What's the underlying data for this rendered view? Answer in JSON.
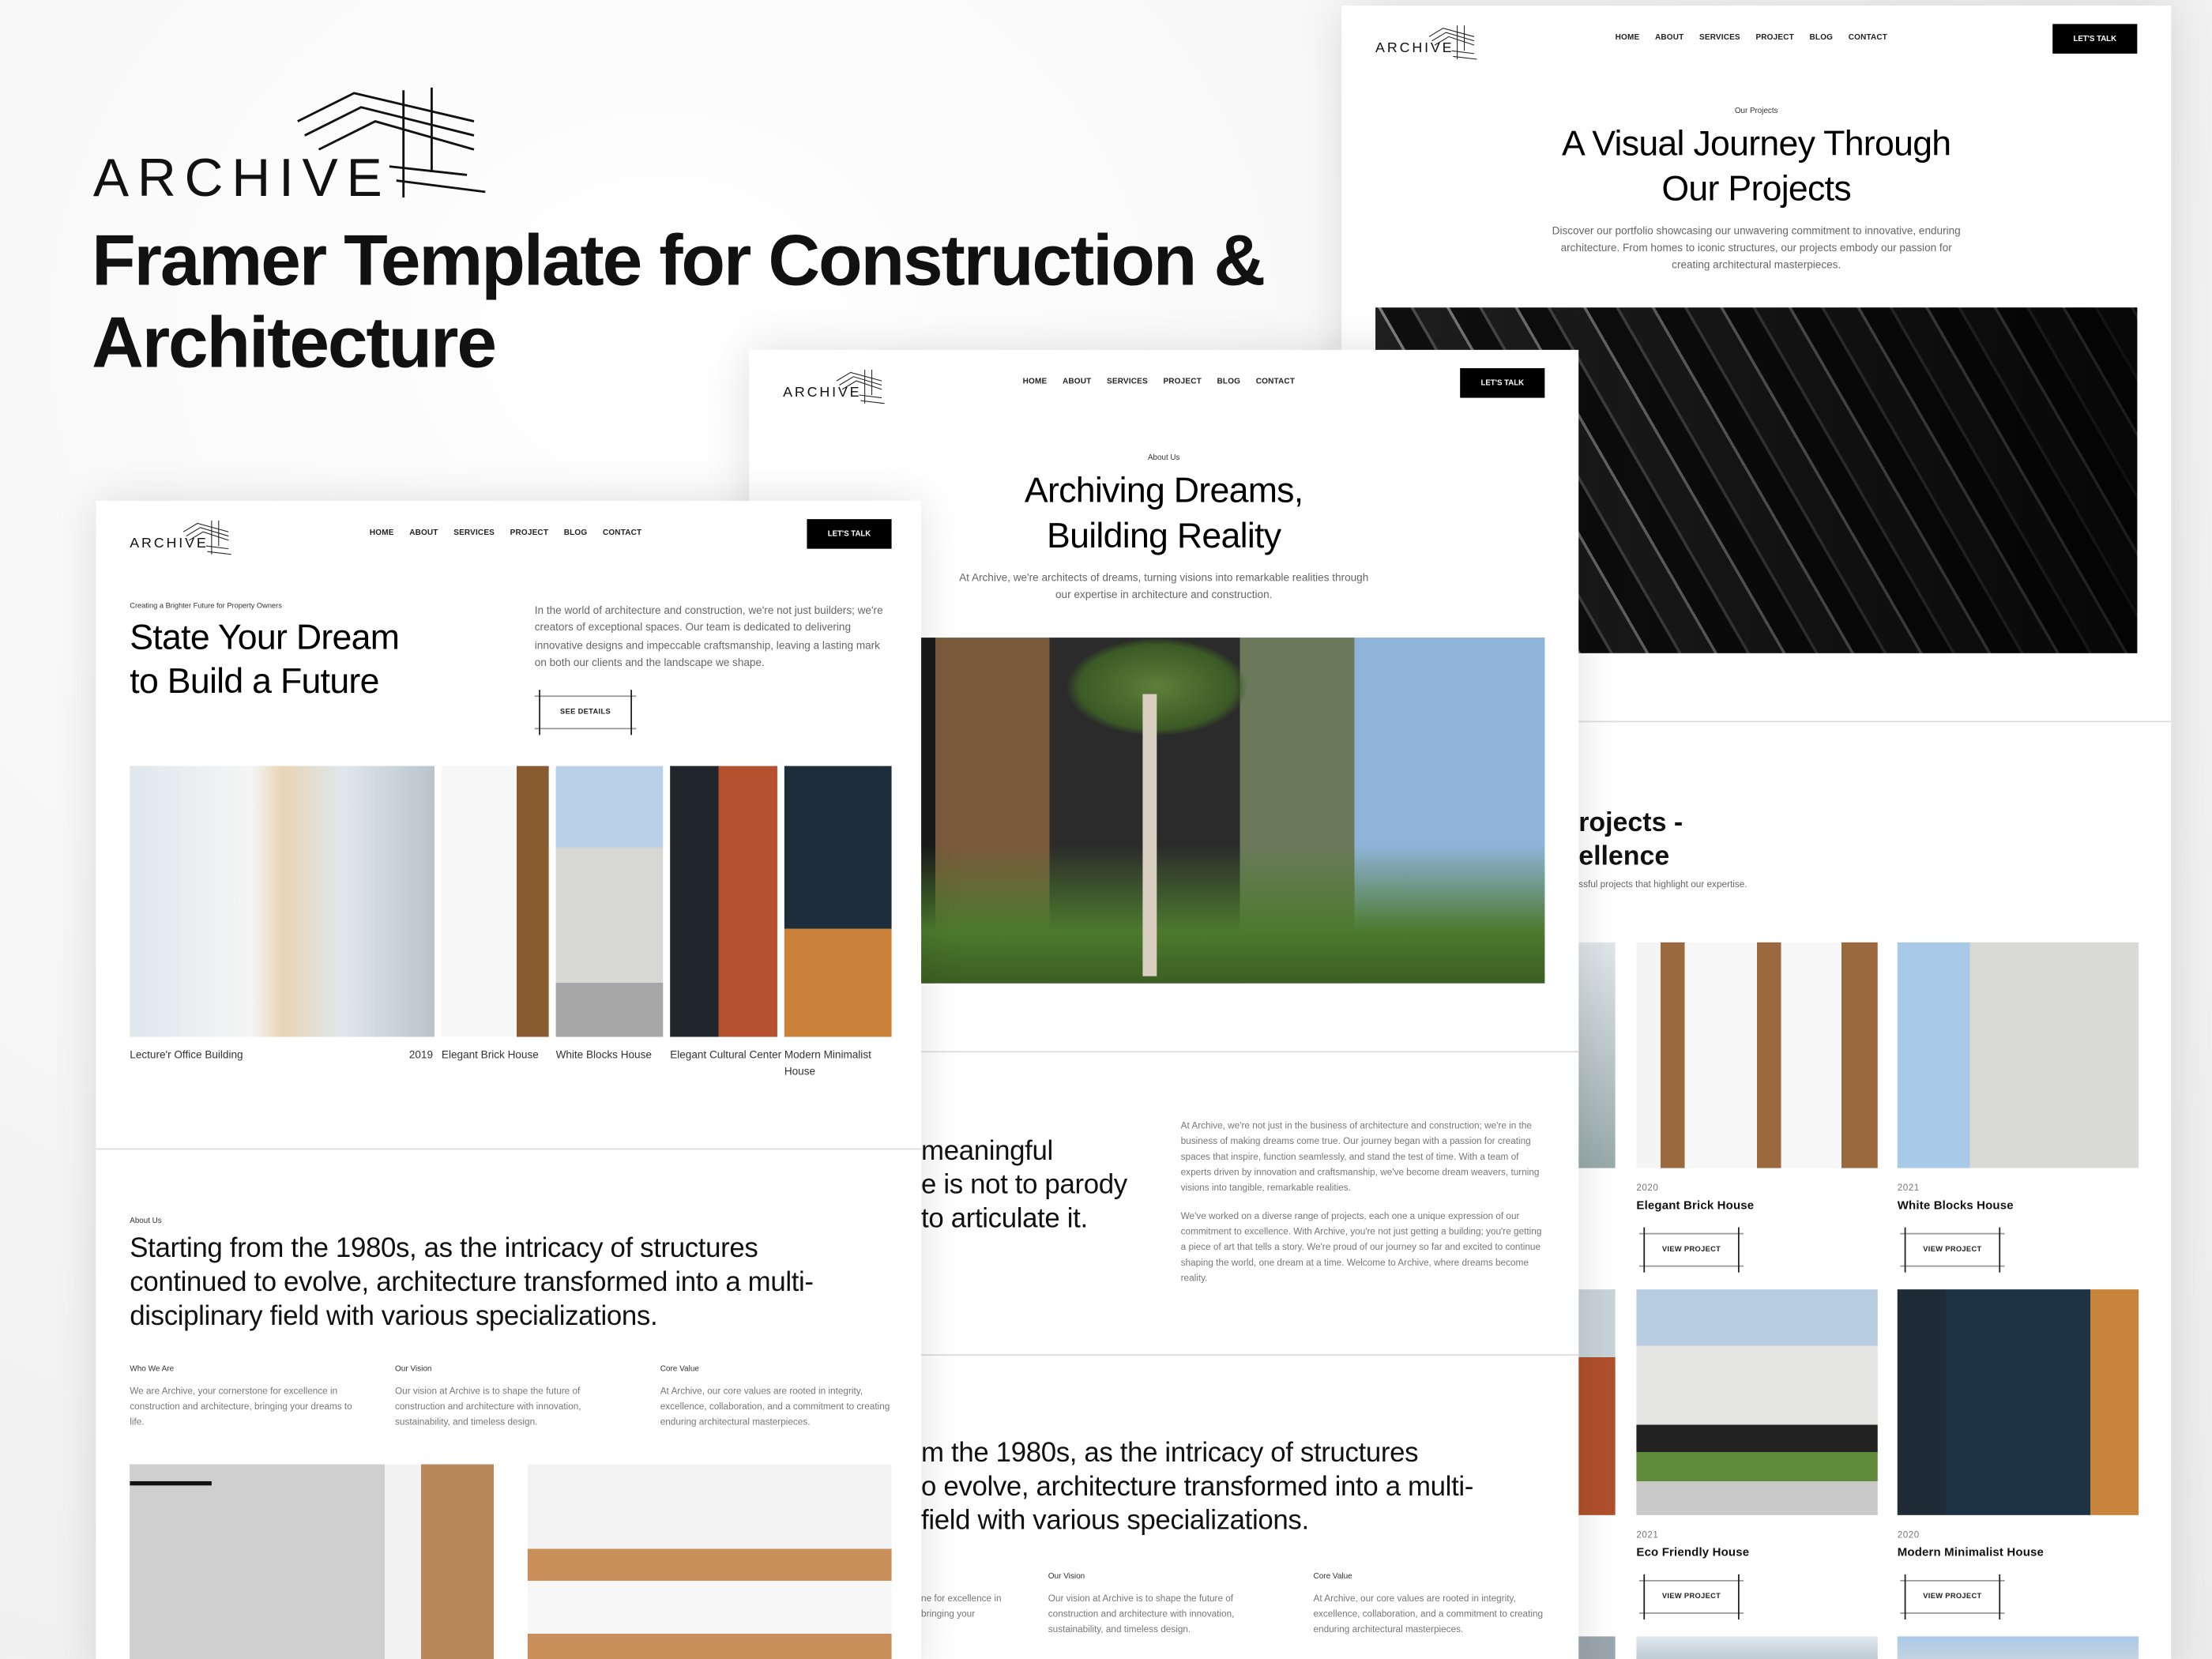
{
  "hero": {
    "logo_text": "ARCHIVE",
    "title_line1": "Framer Template for Construction &",
    "title_line2": "Architecture"
  },
  "nav": {
    "logo_text": "ARCHIVE",
    "items": [
      "HOME",
      "ABOUT",
      "SERVICES",
      "PROJECT",
      "BLOG",
      "CONTACT"
    ],
    "cta": "LET'S TALK"
  },
  "projects_page": {
    "eyebrow": "Our Projects",
    "title_line1": "A Visual Journey Through",
    "title_line2": "Our Projects",
    "description": "Discover our portfolio showcasing our unwavering commitment to innovative, enduring architecture. From homes to iconic structures, our projects embody our passion for creating architectural masterpieces.",
    "section_title_line1": "rojects -",
    "section_title_line2": "ellence",
    "section_sub": "ssful projects that highlight our expertise.",
    "button_label": "VIEW PROJECT",
    "projects": [
      {
        "year": "2020",
        "title": "Elegant Brick House"
      },
      {
        "year": "2021",
        "title": "White Blocks House"
      },
      {
        "year": "2021",
        "title": "Eco Friendly House"
      },
      {
        "year": "2020",
        "title": "Modern Minimalist House"
      }
    ]
  },
  "about_page": {
    "eyebrow": "About Us",
    "title_line1": "Archiving Dreams,",
    "title_line2": "Building Reality",
    "description": "At Archive, we're architects of dreams, turning visions into remarkable realities through our expertise in architecture and construction.",
    "quote_lines": [
      "meaningful",
      "e is not to parody",
      "to articulate it."
    ],
    "paragraph1": "At Archive, we're not just in the business of architecture and construction; we're in the business of making dreams come true. Our journey began with a passion for creating spaces that inspire, function seamlessly, and stand the test of time. With a team of experts driven by innovation and craftsmanship, we've become dream weavers, turning visions into tangible, remarkable realities.",
    "paragraph2": "We've worked on a diverse range of projects, each one a unique expression of our commitment to excellence. With Archive, you're not just getting a building; you're getting a piece of art that tells a story. We're proud of our journey so far and excited to continue shaping the world, one dream at a time. Welcome to Archive, where dreams become reality.",
    "big_lines": [
      "m the 1980s, as the intricacy of structures",
      "o evolve, architecture transformed into a multi-",
      "field with various specializations."
    ],
    "partial_col_lines": [
      "ne for excellence in",
      "bringing your"
    ],
    "vision_title": "Our Vision",
    "vision_text": "Our vision at Archive is to shape the future of construction and architecture with innovation, sustainability, and timeless design.",
    "core_title": "Core Value",
    "core_text": "At Archive, our core values are rooted in integrity, excellence, collaboration, and a commitment to creating enduring architectural masterpieces."
  },
  "home_page": {
    "eyebrow": "Creating a Brighter Future for Property Owners",
    "title_line1": "State Your Dream",
    "title_line2": "to Build a Future",
    "intro": "In the world of architecture and construction, we're not just builders; we're creators of exceptional spaces. Our team is dedicated to delivering innovative designs and impeccable craftsmanship, leaving a lasting mark on both our clients and the landscape we shape.",
    "see_details": "SEE DETAILS",
    "gallery": [
      {
        "caption": "Lecture'r Office Building",
        "year": "2019"
      },
      {
        "caption": "Elegant Brick House"
      },
      {
        "caption": "White Blocks House"
      },
      {
        "caption": "Elegant Cultural Center"
      },
      {
        "caption": "Modern Minimalist House"
      }
    ],
    "about_eyebrow": "About Us",
    "about_text": "Starting from the 1980s, as the intricacy of structures continued to evolve, architecture transformed into a multi-disciplinary field with various specializations.",
    "columns": [
      {
        "title": "Who We Are",
        "text": "We are Archive, your cornerstone for excellence in construction and architecture, bringing your dreams to life."
      },
      {
        "title": "Our Vision",
        "text": "Our vision at Archive is to shape the future of construction and architecture with innovation, sustainability, and timeless design."
      },
      {
        "title": "Core Value",
        "text": "At Archive, our core values are rooted in integrity, excellence, collaboration, and a commitment to creating enduring architectural masterpieces."
      }
    ]
  },
  "colors": {
    "accent": "#000000",
    "background": "#f2f2f2",
    "card": "#ffffff",
    "muted_text": "#777777"
  }
}
